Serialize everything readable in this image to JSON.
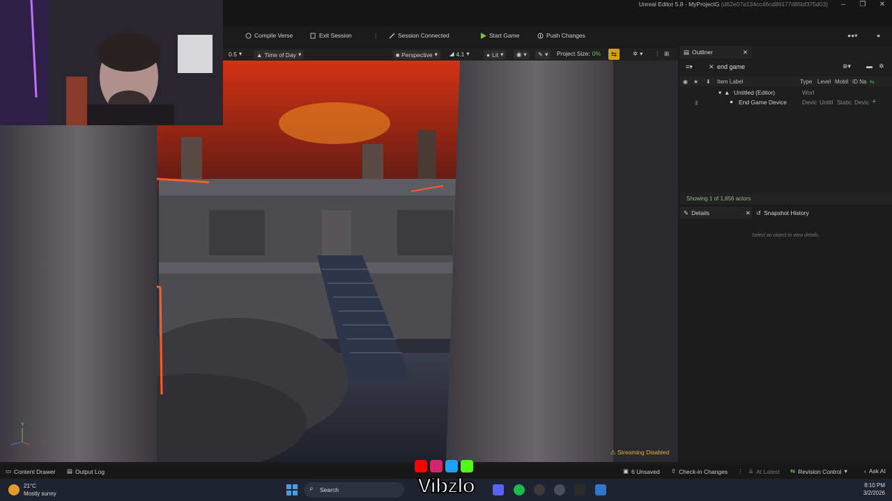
{
  "window": {
    "title": "Unreal Editor 5.8 - MyProjectG",
    "hash": "(d62e07a134cc46cd86177d85bf375d03)"
  },
  "toolbar": {
    "compile_verse": "Compile Verse",
    "exit_session": "Exit Session",
    "session_connected": "Session Connected",
    "start_game": "Start Game",
    "push_changes": "Push Changes"
  },
  "viewport_bar": {
    "speed": "0.5",
    "time_of_day": "Time of Day",
    "perspective": "Perspective",
    "camera_speed": "4.1",
    "lit": "Lit",
    "project_size_label": "Project Size:",
    "project_size_value": "0%"
  },
  "viewport": {
    "status_warning": "Streaming Disabled",
    "gizmo_x": "",
    "gizmo_y": "Y"
  },
  "outliner": {
    "tab_label": "Outliner",
    "search_value": "end game",
    "columns": [
      "Item Label",
      "Type",
      "Level",
      "Mobil",
      "ID Na"
    ],
    "rows": [
      {
        "label": "Untitled (Editor)",
        "type": "Worl",
        "level": "",
        "mobility": "",
        "id": ""
      },
      {
        "label": "End Game Device",
        "type": "Devic",
        "level": "Untitl",
        "mobility": "Static",
        "id": "Devic"
      }
    ],
    "footer": "Showing 1 of 1,856 actors"
  },
  "details": {
    "tab_details": "Details",
    "tab_snapshot": "Snapshot History",
    "empty_message": "Select an object to view details."
  },
  "bottom_bar": {
    "content_drawer": "Content Drawer",
    "output_log": "Output Log",
    "unsaved": "6 Unsaved",
    "checkin": "Check-in Changes",
    "at_latest": "At Latest",
    "revision_control": "Revision Control",
    "ask_ai": "Ask AI"
  },
  "taskbar": {
    "weather_temp": "21°C",
    "weather_desc": "Mostly sunny",
    "search": "Search",
    "time": "8:10 PM",
    "date": "3/2/2026"
  },
  "watermark": {
    "brand": "Vibzlo"
  },
  "colors": {
    "accent_green": "#6cc24a",
    "warning_yellow": "#e2b33c",
    "project_size_icon_bg": "#d4a017",
    "link_green": "#39c26a"
  }
}
